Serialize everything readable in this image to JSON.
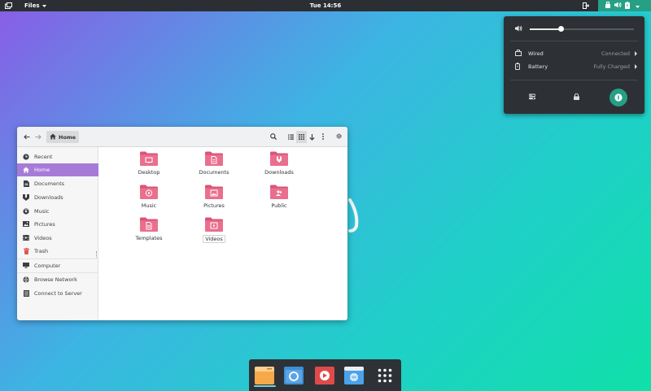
{
  "topbar": {
    "app_menu": "Files",
    "clock": "Tue 14:56",
    "icons": [
      "activities-icon",
      "logout-icon",
      "network-icon",
      "volume-icon",
      "battery-icon",
      "chevron-down-icon"
    ]
  },
  "status_menu": {
    "volume_level": 0.3,
    "rows": [
      {
        "label": "Wired",
        "value": "Connected",
        "icon": "wired-network-icon"
      },
      {
        "label": "Battery",
        "value": "Fully Charged",
        "icon": "battery-icon"
      }
    ],
    "actions": [
      "settings-icon",
      "lock-icon",
      "power-icon"
    ]
  },
  "window": {
    "location": "Home"
  },
  "sidebar": {
    "items": [
      {
        "label": "Recent",
        "icon": "clock-icon"
      },
      {
        "label": "Home",
        "icon": "home-icon"
      },
      {
        "label": "Documents",
        "icon": "documents-icon"
      },
      {
        "label": "Downloads",
        "icon": "downloads-icon"
      },
      {
        "label": "Music",
        "icon": "music-icon"
      },
      {
        "label": "Pictures",
        "icon": "pictures-icon"
      },
      {
        "label": "Videos",
        "icon": "videos-icon"
      },
      {
        "label": "Trash",
        "icon": "trash-icon"
      },
      {
        "label": "Computer",
        "icon": "computer-icon"
      },
      {
        "label": "Browse Network",
        "icon": "network-icon"
      },
      {
        "label": "Connect to Server",
        "icon": "server-icon"
      }
    ]
  },
  "folders": [
    {
      "name": "Desktop",
      "icon": "desktop-icon"
    },
    {
      "name": "Documents",
      "icon": "documents-icon"
    },
    {
      "name": "Downloads",
      "icon": "downloads-icon"
    },
    {
      "name": "Music",
      "icon": "music-icon"
    },
    {
      "name": "Pictures",
      "icon": "pictures-icon"
    },
    {
      "name": "Public",
      "icon": "public-icon"
    },
    {
      "name": "Templates",
      "icon": "templates-icon"
    },
    {
      "name": "Videos",
      "icon": "videos-icon"
    }
  ],
  "colors": {
    "accent_teal": "#26a085",
    "sidebar_active": "#a67bd8",
    "folder_pink": "#ea6f8e"
  },
  "dock": {
    "items": [
      "files-icon",
      "browser-icon",
      "video-player-icon",
      "web-icon",
      "app-grid-icon"
    ]
  }
}
